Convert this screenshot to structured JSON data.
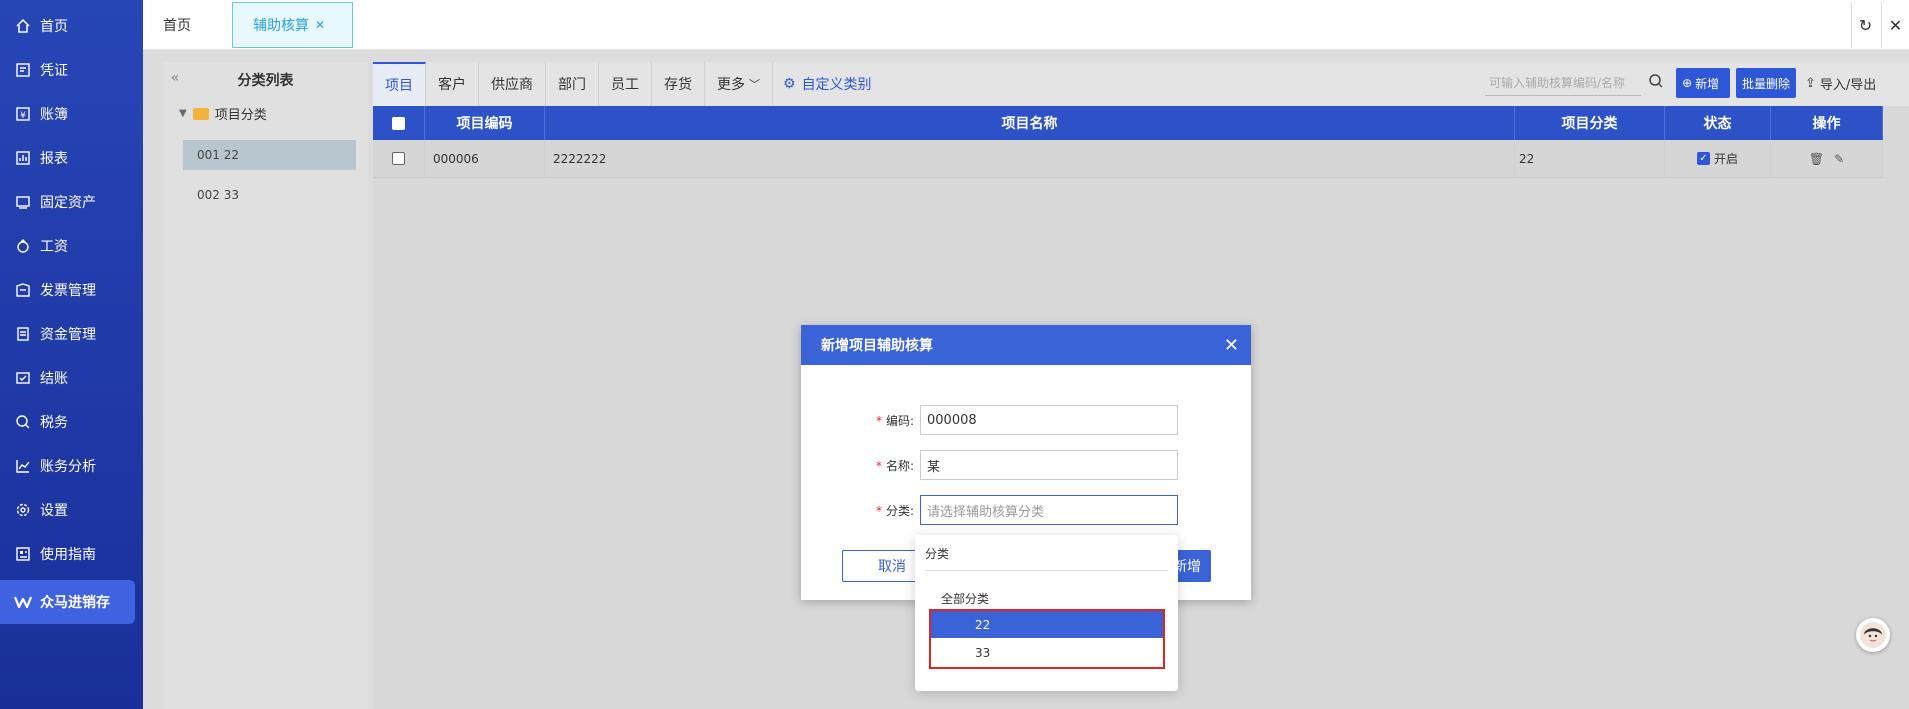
{
  "sidebar": {
    "items": [
      {
        "label": "首页",
        "icon": "home-icon"
      },
      {
        "label": "凭证",
        "icon": "voucher-icon"
      },
      {
        "label": "账簿",
        "icon": "ledger-icon"
      },
      {
        "label": "报表",
        "icon": "report-icon"
      },
      {
        "label": "固定资产",
        "icon": "asset-icon"
      },
      {
        "label": "工资",
        "icon": "salary-icon"
      },
      {
        "label": "发票管理",
        "icon": "invoice-icon"
      },
      {
        "label": "资金管理",
        "icon": "fund-icon"
      },
      {
        "label": "结账",
        "icon": "closing-icon"
      },
      {
        "label": "税务",
        "icon": "tax-icon"
      },
      {
        "label": "账务分析",
        "icon": "chart-icon"
      },
      {
        "label": "设置",
        "icon": "gear-icon"
      },
      {
        "label": "使用指南",
        "icon": "guide-icon"
      }
    ],
    "brand": "众马进销存"
  },
  "topbar": {
    "tabs": [
      {
        "label": "首页"
      },
      {
        "label": "辅助核算"
      }
    ]
  },
  "category_panel": {
    "title": "分类列表",
    "root": "项目分类",
    "items": [
      "001 22",
      "002 33"
    ]
  },
  "subtabs": [
    "项目",
    "客户",
    "供应商",
    "部门",
    "员工",
    "存货",
    "更多"
  ],
  "custom_category": "自定义类别",
  "search": {
    "placeholder": "可输入辅助核算编码/名称"
  },
  "actions": {
    "new": "新增",
    "batch_delete": "批量删除",
    "import_export": "导入/导出"
  },
  "table": {
    "headers": [
      "项目编码",
      "项目名称",
      "项目分类",
      "状态",
      "操作"
    ],
    "rows": [
      {
        "code": "000006",
        "name": "2222222",
        "category": "22",
        "status": "开启"
      }
    ]
  },
  "modal": {
    "title": "新增项目辅助核算",
    "fields": [
      {
        "label": "编码:",
        "value": "000008"
      },
      {
        "label": "名称:",
        "value": "某"
      },
      {
        "label": "分类:",
        "placeholder": "请选择辅助核算分类"
      }
    ],
    "cancel": "取消",
    "confirm": "新增"
  },
  "dropdown": {
    "label": "分类",
    "all": "全部分类",
    "options": [
      "22",
      "33"
    ]
  },
  "colors": {
    "primary": "#2d57d6",
    "sidebar": "#2746b6",
    "highlight": "#e02424"
  }
}
